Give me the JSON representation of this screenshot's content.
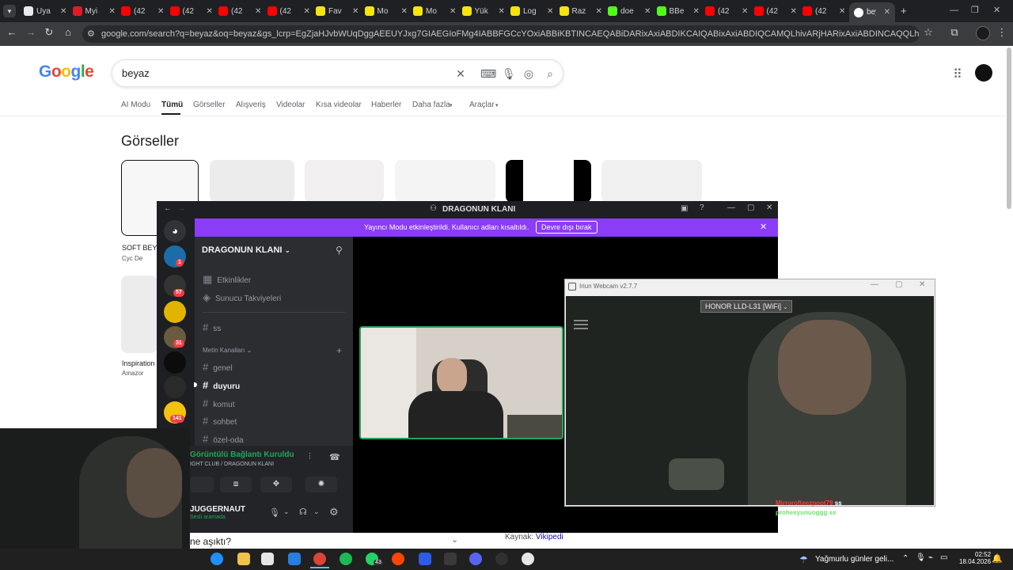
{
  "browser": {
    "tabs": [
      {
        "label": "Uya",
        "color": "#e8eaed"
      },
      {
        "label": "Myi",
        "color": "#e01b24"
      },
      {
        "label": "(42",
        "color": "#ff0000"
      },
      {
        "label": "(42",
        "color": "#ff0000"
      },
      {
        "label": "(42",
        "color": "#ff0000"
      },
      {
        "label": "(42",
        "color": "#ff0000"
      },
      {
        "label": "Fav",
        "color": "#f5e50a"
      },
      {
        "label": "Mo",
        "color": "#f5e50a"
      },
      {
        "label": "Mo",
        "color": "#f5e50a"
      },
      {
        "label": "Yük",
        "color": "#f5e50a"
      },
      {
        "label": "Log",
        "color": "#f5e50a"
      },
      {
        "label": "Raz",
        "color": "#f5e50a"
      },
      {
        "label": "doe",
        "color": "#53fc18"
      },
      {
        "label": "BBe",
        "color": "#53fc18"
      },
      {
        "label": "(42",
        "color": "#ff0000"
      },
      {
        "label": "(42",
        "color": "#ff0000"
      },
      {
        "label": "(42",
        "color": "#ff0000"
      }
    ],
    "active_tab": "bey",
    "new_tab": "+",
    "url": "google.com/search?q=beyaz&oq=beyaz&gs_lcrp=EgZjaHJvbWUqDggAEEUYJxg7GIAEGIoFMg4IABBFGCcYOxiABBiKBTINCAEQABiDARixAxiABDIKCAIQABixAxiABDIQCAMQLhivARjHARixAxiABDINCAQQLhiDARixAxiABDIHCAUQABiDARi..."
  },
  "google": {
    "logo": "Google",
    "query": "beyaz",
    "tabs": [
      "AI Modu",
      "Tümü",
      "Görseller",
      "Alışveriş",
      "Videolar",
      "Kısa videolar",
      "Haberler",
      "Daha fazla",
      "Araçlar"
    ],
    "section_title": "Görseller",
    "result1_title": "SOFT BEY",
    "result1_source": "Cyc De",
    "result2_title": "Inspiration",
    "result2_source": "Amazor",
    "question": "ne aşıktı?",
    "source_label": "Kaynak:",
    "source_link": "Vikipedi"
  },
  "discord": {
    "window_title": "DRAGONUN KLANI",
    "banner_text": "Yayıncı Modu etkinleştirildi. Kullanıcı adları kısaltıldı.",
    "banner_button": "Devre dışı bırak",
    "server_name": "DRAGONUN KLANI",
    "events": "Etkinlikler",
    "boosts": "Sunucu Takviyeleri",
    "category": "Metin Kanalları",
    "channels": [
      "ss",
      "genel",
      "duyuru",
      "komut",
      "sohbet",
      "özel-oda"
    ],
    "voice_status": "Görüntülü Bağlantı Kuruldu",
    "voice_channel": "IGHT CLUB / DRAGONUN KLANI",
    "user_name": "JUGGERNAUT",
    "user_status": "Sesli aramada",
    "guild_badges": [
      "1",
      "57",
      "31",
      "141"
    ]
  },
  "iriun": {
    "title": "Iriun Webcam v2.7.7",
    "device": "HONOR LLD-L31 [WiFi]",
    "chat_line1": "Mirrorofteezpoot79",
    "chat_line1_tail": "ss",
    "chat_line2": "prohexyunuoggg",
    "chat_line2_tail": "ss"
  },
  "taskbar": {
    "weather": "Yağmurlu günler geli...",
    "time": "02:52",
    "date": "18.04.2026",
    "whatsapp_badge": "43"
  }
}
